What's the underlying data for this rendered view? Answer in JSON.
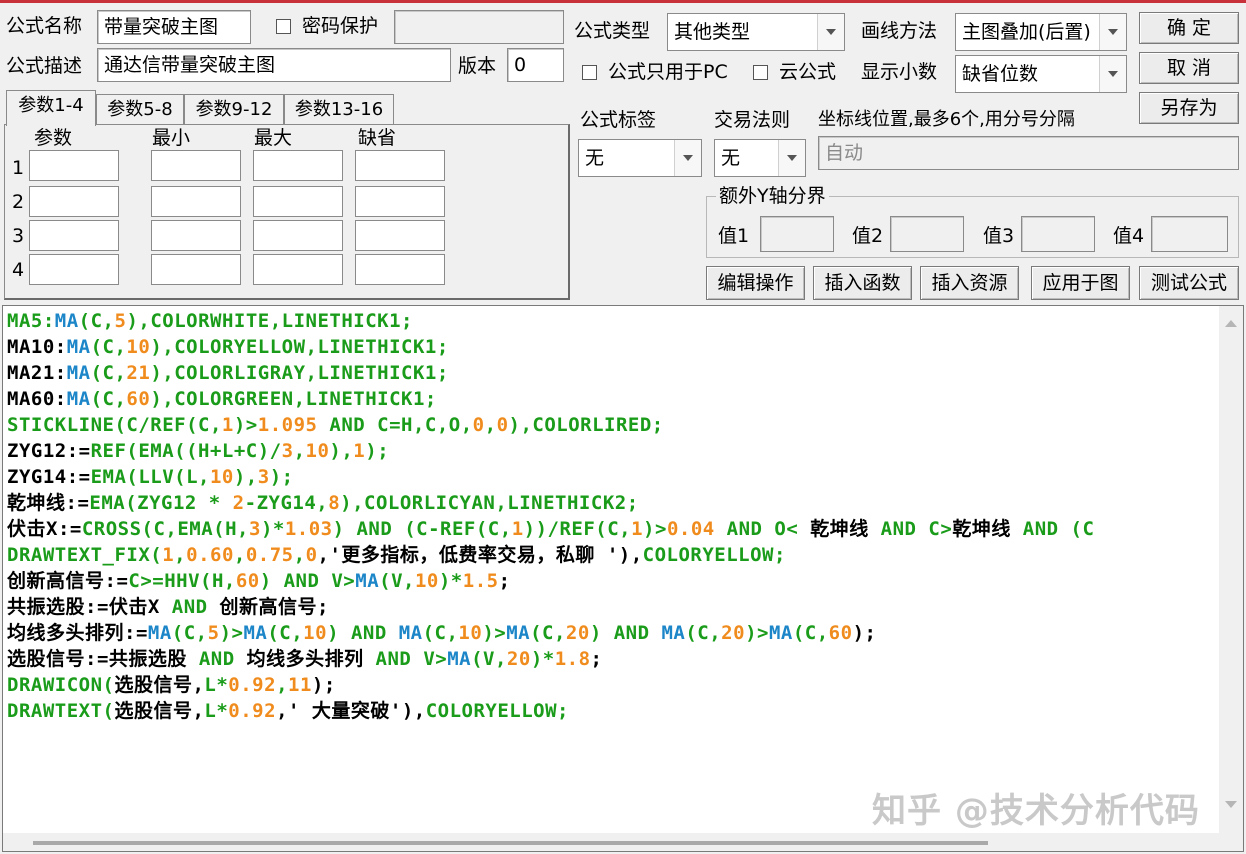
{
  "header": {
    "name_label": "公式名称",
    "name_value": "带量突破主图",
    "password_label": "密码保护",
    "desc_label": "公式描述",
    "desc_value": "通达信带量突破主图",
    "version_label": "版本",
    "version_value": "0",
    "type_label": "公式类型",
    "type_value": "其他类型",
    "draw_label": "画线方法",
    "draw_value": "主图叠加(后置)",
    "pc_only_label": "公式只用于PC",
    "cloud_label": "云公式",
    "decimals_label": "显示小数",
    "decimals_value": "缺省位数"
  },
  "buttons": {
    "ok": "确  定",
    "cancel": "取  消",
    "save_as": "另存为",
    "edit_ops": "编辑操作",
    "insert_func": "插入函数",
    "insert_res": "插入资源",
    "apply_chart": "应用于图",
    "test": "测试公式"
  },
  "params": {
    "tabs": [
      "参数1-4",
      "参数5-8",
      "参数9-12",
      "参数13-16"
    ],
    "columns": [
      "参数",
      "最小",
      "最大",
      "缺省"
    ],
    "rows": [
      "1",
      "2",
      "3",
      "4"
    ]
  },
  "options": {
    "tag_label": "公式标签",
    "tag_value": "无",
    "trade_label": "交易法则",
    "trade_value": "无",
    "coord_label": "坐标线位置,最多6个,用分号分隔",
    "coord_value": "自动",
    "extra_y_label": "额外Y轴分界",
    "v1": "值1",
    "v2": "值2",
    "v3": "值3",
    "v4": "值4"
  },
  "colors": {
    "green": "#1a9c1a",
    "blue": "#1c86c8",
    "orange": "#f08c1e",
    "black": "#000000"
  },
  "code": [
    [
      [
        "MA5:",
        "green"
      ],
      [
        "MA",
        "blue"
      ],
      [
        "(C,",
        "green"
      ],
      [
        "5",
        "orange"
      ],
      [
        "),COLORWHITE,LINETHICK1;",
        "green"
      ]
    ],
    [
      [
        "MA10:",
        "black"
      ],
      [
        "MA",
        "blue"
      ],
      [
        "(C,",
        "green"
      ],
      [
        "10",
        "orange"
      ],
      [
        "),COLORYELLOW,LINETHICK1;",
        "green"
      ]
    ],
    [
      [
        "MA21:",
        "black"
      ],
      [
        "MA",
        "blue"
      ],
      [
        "(C,",
        "green"
      ],
      [
        "21",
        "orange"
      ],
      [
        "),COLORLIGRAY,LINETHICK1;",
        "green"
      ]
    ],
    [
      [
        "MA60:",
        "black"
      ],
      [
        "MA",
        "blue"
      ],
      [
        "(C,",
        "green"
      ],
      [
        "60",
        "orange"
      ],
      [
        "),COLORGREEN,LINETHICK1;",
        "green"
      ]
    ],
    [
      [
        "STICKLINE(C/REF(C,",
        "green"
      ],
      [
        "1",
        "orange"
      ],
      [
        ")>",
        "green"
      ],
      [
        "1.095",
        "orange"
      ],
      [
        " AND C=H,C,O,",
        "green"
      ],
      [
        "0",
        "orange"
      ],
      [
        ",",
        "green"
      ],
      [
        "0",
        "orange"
      ],
      [
        "),COLORLIRED;",
        "green"
      ]
    ],
    [
      [
        "ZYG12:=",
        "black"
      ],
      [
        "REF(EMA((H+L+C)/",
        "green"
      ],
      [
        "3",
        "orange"
      ],
      [
        ",",
        "green"
      ],
      [
        "10",
        "orange"
      ],
      [
        "),",
        "green"
      ],
      [
        "1",
        "orange"
      ],
      [
        ");",
        "green"
      ]
    ],
    [
      [
        "ZYG14:=",
        "black"
      ],
      [
        "EMA(LLV(L,",
        "green"
      ],
      [
        "10",
        "orange"
      ],
      [
        "),",
        "green"
      ],
      [
        "3",
        "orange"
      ],
      [
        ");",
        "green"
      ]
    ],
    [
      [
        "乾坤线:=",
        "black"
      ],
      [
        "EMA(ZYG12 * ",
        "green"
      ],
      [
        "2",
        "orange"
      ],
      [
        "-ZYG14,",
        "green"
      ],
      [
        "8",
        "orange"
      ],
      [
        "),COLORLICYAN,LINETHICK2;",
        "green"
      ]
    ],
    [
      [
        "伏击X:=",
        "black"
      ],
      [
        "CROSS(C,EMA(H,",
        "green"
      ],
      [
        "3",
        "orange"
      ],
      [
        ")*",
        "green"
      ],
      [
        "1.03",
        "orange"
      ],
      [
        ") AND (C-REF(C,",
        "green"
      ],
      [
        "1",
        "orange"
      ],
      [
        "))/REF(C,",
        "green"
      ],
      [
        "1",
        "orange"
      ],
      [
        ")>",
        "green"
      ],
      [
        "0.04",
        "orange"
      ],
      [
        " AND O< ",
        "green"
      ],
      [
        "乾坤线",
        "black"
      ],
      [
        " AND C>",
        "green"
      ],
      [
        "乾坤线",
        "black"
      ],
      [
        " AND (C",
        "green"
      ]
    ],
    [
      [
        "DRAWTEXT_FIX(",
        "green"
      ],
      [
        "1",
        "orange"
      ],
      [
        ",",
        "green"
      ],
      [
        "0.60",
        "orange"
      ],
      [
        ",",
        "green"
      ],
      [
        "0.75",
        "orange"
      ],
      [
        ",",
        "green"
      ],
      [
        "0",
        "orange"
      ],
      [
        ",'更多指标，低费率交易，私聊 '),",
        "black"
      ],
      [
        "COLORYELLOW;",
        "green"
      ]
    ],
    [
      [
        "创新高信号:=",
        "black"
      ],
      [
        "C>=HHV(H,",
        "green"
      ],
      [
        "60",
        "orange"
      ],
      [
        ") AND V>",
        "green"
      ],
      [
        "MA",
        "blue"
      ],
      [
        "(V,",
        "green"
      ],
      [
        "10",
        "orange"
      ],
      [
        ")*",
        "green"
      ],
      [
        "1.5",
        "orange"
      ],
      [
        ";",
        "black"
      ]
    ],
    [
      [
        "共振选股:=伏击X ",
        "black"
      ],
      [
        "AND",
        "green"
      ],
      [
        " 创新高信号;",
        "black"
      ]
    ],
    [
      [
        "均线多头排列:=",
        "black"
      ],
      [
        "MA",
        "blue"
      ],
      [
        "(C,",
        "green"
      ],
      [
        "5",
        "orange"
      ],
      [
        ")>",
        "green"
      ],
      [
        "MA",
        "blue"
      ],
      [
        "(C,",
        "green"
      ],
      [
        "10",
        "orange"
      ],
      [
        ") AND ",
        "green"
      ],
      [
        "MA",
        "blue"
      ],
      [
        "(C,",
        "green"
      ],
      [
        "10",
        "orange"
      ],
      [
        ")>",
        "green"
      ],
      [
        "MA",
        "blue"
      ],
      [
        "(C,",
        "green"
      ],
      [
        "20",
        "orange"
      ],
      [
        ") AND ",
        "green"
      ],
      [
        "MA",
        "blue"
      ],
      [
        "(C,",
        "green"
      ],
      [
        "20",
        "orange"
      ],
      [
        ")>",
        "green"
      ],
      [
        "MA",
        "blue"
      ],
      [
        "(C,",
        "green"
      ],
      [
        "60",
        "orange"
      ],
      [
        ");",
        "black"
      ]
    ],
    [
      [
        "选股信号:=共振选股 ",
        "black"
      ],
      [
        "AND",
        "green"
      ],
      [
        " 均线多头排列 ",
        "black"
      ],
      [
        "AND",
        "green"
      ],
      [
        " V>",
        "green"
      ],
      [
        "MA",
        "blue"
      ],
      [
        "(V,",
        "green"
      ],
      [
        "20",
        "orange"
      ],
      [
        ")*",
        "green"
      ],
      [
        "1.8",
        "orange"
      ],
      [
        ";",
        "black"
      ]
    ],
    [
      [
        "DRAWICON(",
        "green"
      ],
      [
        "选股信号,",
        "black"
      ],
      [
        "L*",
        "green"
      ],
      [
        "0.92",
        "orange"
      ],
      [
        ",",
        "green"
      ],
      [
        "11",
        "orange"
      ],
      [
        ");",
        "black"
      ]
    ],
    [
      [
        "DRAWTEXT(",
        "green"
      ],
      [
        "选股信号,",
        "black"
      ],
      [
        "L*",
        "green"
      ],
      [
        "0.92",
        "orange"
      ],
      [
        ",' 大量突破'),",
        "black"
      ],
      [
        "COLORYELLOW;",
        "green"
      ]
    ]
  ],
  "watermark": "知乎 @技术分析代码"
}
